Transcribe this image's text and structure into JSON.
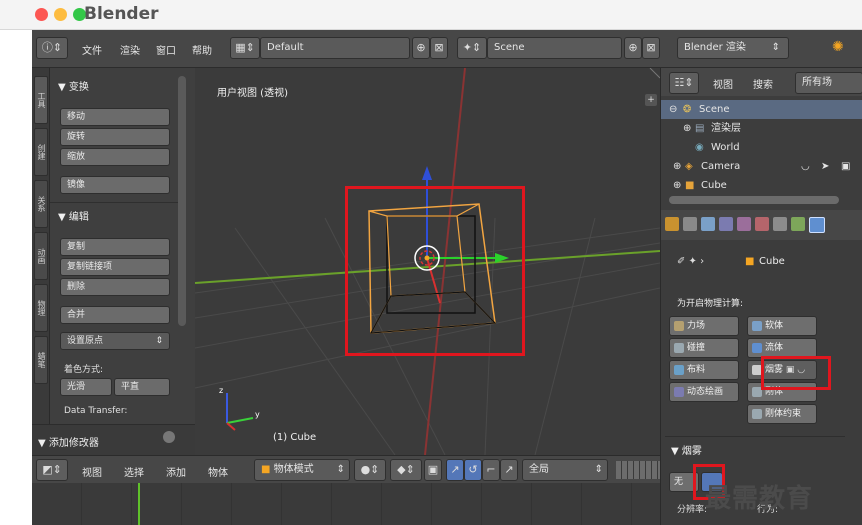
{
  "app": {
    "title": "Blender"
  },
  "header": {
    "menus": [
      "文件",
      "渲染",
      "窗口",
      "帮助"
    ],
    "layout": "Default",
    "scene": "Scene",
    "engine": "Blender 渲染"
  },
  "toolshelf": {
    "tabs": [
      "工具",
      "创建",
      "关系",
      "动画",
      "物理",
      "蜡笔"
    ],
    "transform_header": "▼ 变换",
    "transform_buttons": [
      "移动",
      "旋转",
      "缩放",
      "镜像"
    ],
    "edit_header": "▼ 编辑",
    "edit_buttons": [
      "复制",
      "复制链接项",
      "删除",
      "合并"
    ],
    "set_origin": "设置原点",
    "shading_label": "着色方式:",
    "smooth": "光滑",
    "flat": "平直",
    "data_transfer": "Data Transfer:",
    "add_modifier": "▼ 添加修改器"
  },
  "viewport": {
    "title": "用户视图 (透视)",
    "object_label": "(1) Cube",
    "axis_z": "z",
    "axis_y": "y"
  },
  "bottombar": {
    "menus": [
      "视图",
      "选择",
      "添加",
      "物体"
    ],
    "mode": "物体模式",
    "pivot": "全局"
  },
  "outliner": {
    "header": {
      "view": "视图",
      "search": "搜索",
      "filter": "所有场"
    },
    "items": [
      "Scene",
      "渲染层",
      "World",
      "Camera",
      "Cube"
    ]
  },
  "properties": {
    "breadcrumb_object": "Cube",
    "physics_label": "为开启物理计算:",
    "buttons": {
      "force_field": "力场",
      "soft_body": "软体",
      "collision": "碰撞",
      "fluid": "流体",
      "cloth": "布料",
      "smoke": "烟雾",
      "dynamic_paint": "动态绘画",
      "rigid_body": "刚体",
      "rigid_body_constraint": "刚体约束"
    },
    "smoke_section": "▼ 烟雾",
    "smoke_type_none": "无",
    "resolution": "分辨率:",
    "behavior": "行为:"
  },
  "watermark": "最需教育",
  "colors": {
    "highlight": "#e0161e",
    "selection": "#f5a623",
    "panel": "#3f3f3f",
    "button": "#6b6b6b"
  }
}
